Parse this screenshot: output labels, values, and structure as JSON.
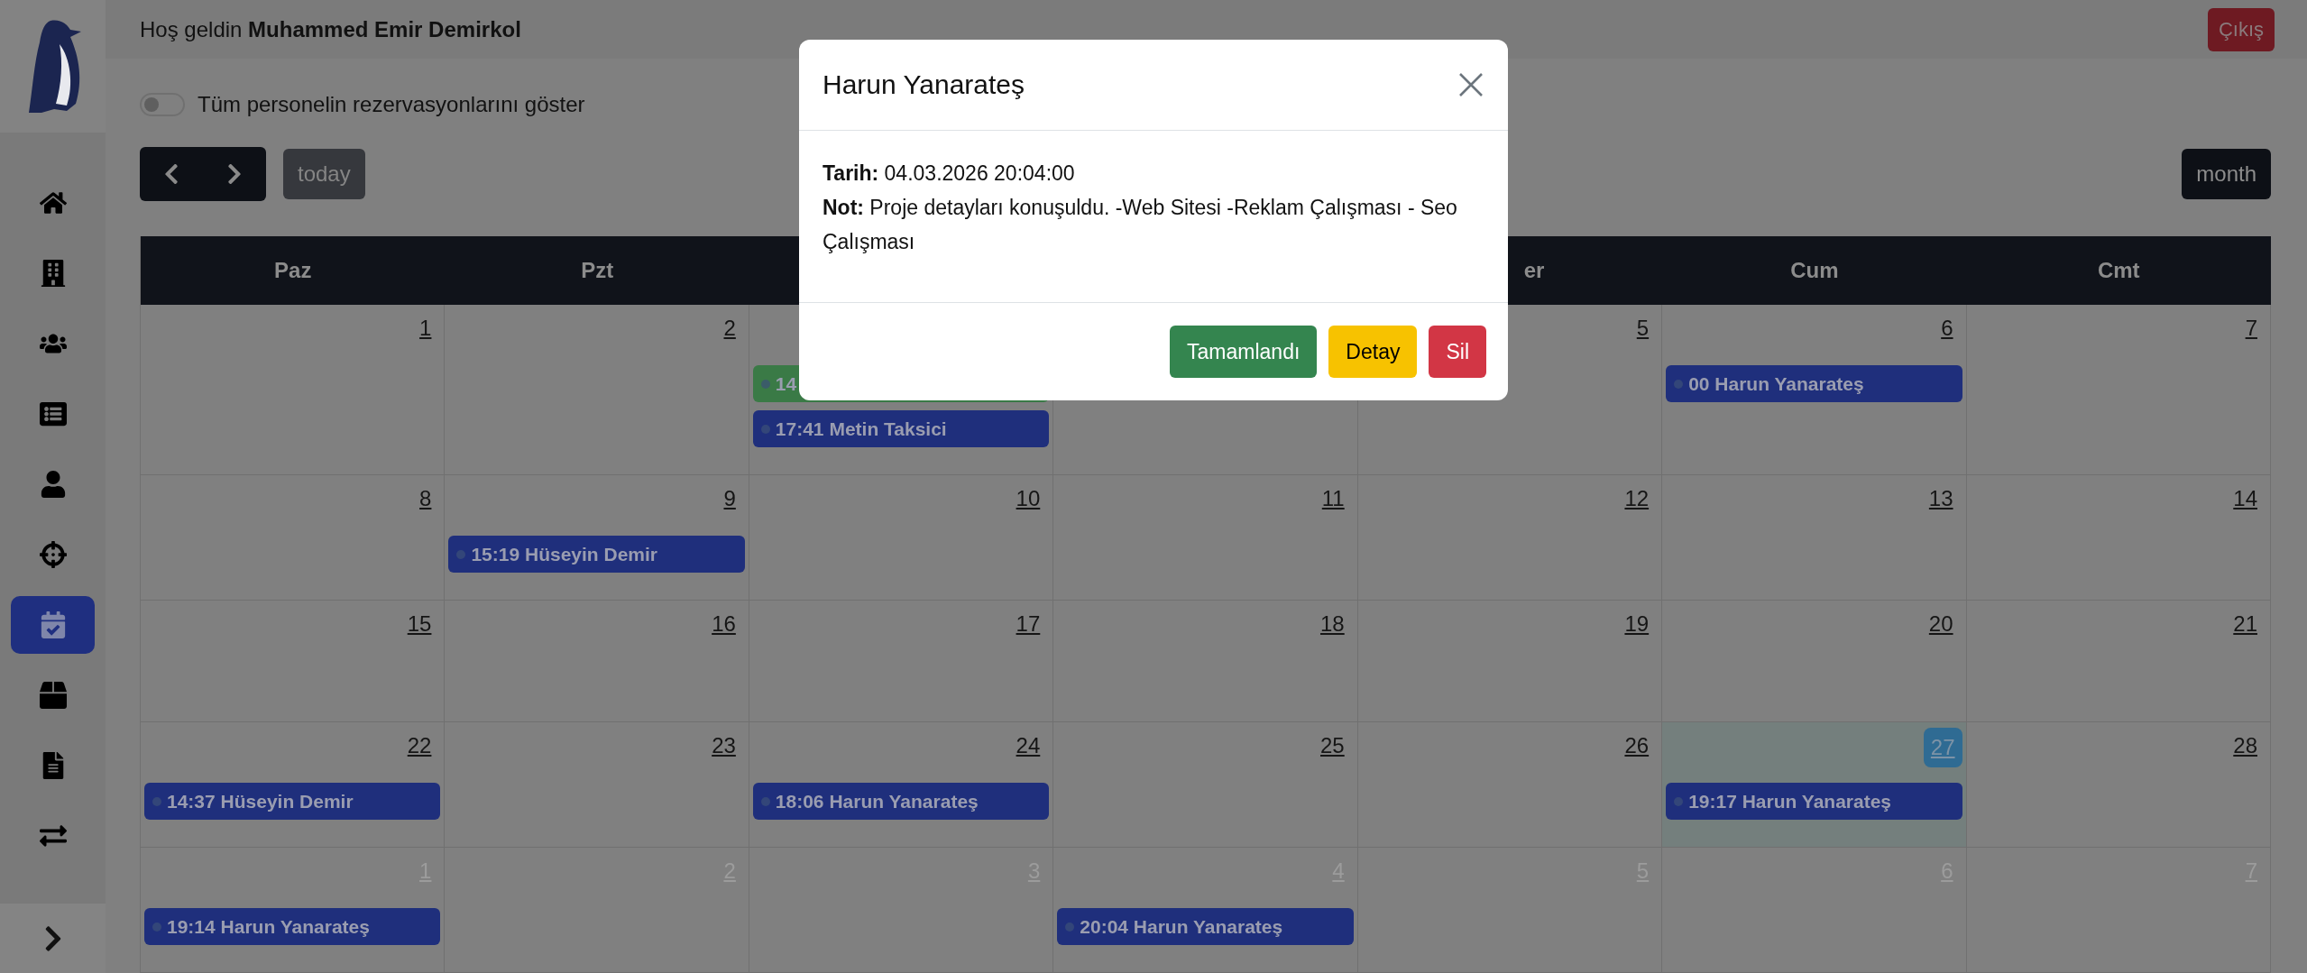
{
  "header": {
    "greeting": "Hoş geldin **Muhammed Emir Demirkol**",
    "logout": "Çıkış"
  },
  "sidebar": {
    "items": [
      {
        "selected": false
      },
      {
        "selected": false
      },
      {
        "selected": false
      },
      {
        "selected": false
      },
      {
        "selected": false
      },
      {
        "selected": false
      },
      {
        "selected": true
      },
      {
        "selected": false
      },
      {
        "selected": false
      },
      {
        "selected": false
      }
    ]
  },
  "toggle": {
    "label": "Tüm personelin rezervasyonlarını göster",
    "on": false
  },
  "toolbar": {
    "today": {
      "label": "today",
      "disabled": true
    },
    "view": {
      "label": "month",
      "selected": true
    }
  },
  "calendar": {
    "weekdays_left": [
      {
        "label": "Paz"
      },
      {
        "label": "Pzt"
      }
    ],
    "weekdays_right": [
      {
        "label": "er",
        "cut": true
      },
      {
        "label": "Cum"
      },
      {
        "label": "Cmt"
      }
    ],
    "weeks": [
      {
        "days": [
          {
            "number": "1",
            "other_month": false,
            "today": false
          },
          {
            "number": "2",
            "other_month": false,
            "today": false
          },
          {
            "today": false,
            "events": [
              {
                "title": "14",
                "color": "#3a7a46"
              },
              {
                "title": "17:41 Metin Taksici",
                "color": "#1f2f7c"
              }
            ]
          },
          {
            "today": false
          },
          {
            "number": "5",
            "other_month": false,
            "today": false
          },
          {
            "number": "6",
            "other_month": false,
            "today": false,
            "events": [
              {
                "title": "00 Harun Yanarateş",
                "color": "#1f2f7c"
              }
            ]
          },
          {
            "number": "7",
            "other_month": false,
            "today": false
          }
        ]
      },
      {
        "days": [
          {
            "number": "8",
            "other_month": false,
            "today": false
          },
          {
            "number": "9",
            "other_month": false,
            "today": false,
            "events": [
              {
                "title": "15:19 Hüseyin Demir",
                "color": "#1f2f7c"
              }
            ]
          },
          {
            "number": "10",
            "other_month": false,
            "today": false
          },
          {
            "number": "11",
            "other_month": false,
            "today": false
          },
          {
            "number": "12",
            "other_month": false,
            "today": false
          },
          {
            "number": "13",
            "other_month": false,
            "today": false
          },
          {
            "number": "14",
            "other_month": false,
            "today": false
          }
        ]
      },
      {
        "days": [
          {
            "number": "15",
            "other_month": false,
            "today": false
          },
          {
            "number": "16",
            "other_month": false,
            "today": false
          },
          {
            "number": "17",
            "other_month": false,
            "today": false
          },
          {
            "number": "18",
            "other_month": false,
            "today": false
          },
          {
            "number": "19",
            "other_month": false,
            "today": false
          },
          {
            "number": "20",
            "other_month": false,
            "today": false
          },
          {
            "number": "21",
            "other_month": false,
            "today": false
          }
        ]
      },
      {
        "days": [
          {
            "number": "22",
            "other_month": false,
            "today": false,
            "events": [
              {
                "title": "14:37 Hüseyin Demir",
                "color": "#1f2f7c"
              }
            ]
          },
          {
            "number": "23",
            "other_month": false,
            "today": false
          },
          {
            "number": "24",
            "other_month": false,
            "today": false,
            "events": [
              {
                "title": "18:06 Harun Yanarateş",
                "color": "#1f2f7c"
              }
            ]
          },
          {
            "number": "25",
            "other_month": false,
            "today": false
          },
          {
            "number": "26",
            "other_month": false,
            "today": false
          },
          {
            "number": "27",
            "other_month": false,
            "today": true,
            "events": [
              {
                "title": "19:17 Harun Yanarateş",
                "color": "#1f2f7c"
              }
            ]
          },
          {
            "number": "28",
            "other_month": false,
            "today": false
          }
        ]
      },
      {
        "days": [
          {
            "number": "1",
            "other_month": true,
            "today": false,
            "events": [
              {
                "title": "19:14 Harun Yanarateş",
                "color": "#1f2f7c"
              }
            ]
          },
          {
            "number": "2",
            "other_month": true,
            "today": false
          },
          {
            "number": "3",
            "other_month": true,
            "today": false
          },
          {
            "number": "4",
            "other_month": true,
            "today": false,
            "events": [
              {
                "title": "20:04 Harun Yanarateş",
                "color": "#1f2f7c"
              }
            ]
          },
          {
            "number": "5",
            "other_month": true,
            "today": false
          },
          {
            "number": "6",
            "other_month": true,
            "today": false
          },
          {
            "number": "7",
            "other_month": true,
            "today": false
          }
        ]
      }
    ]
  },
  "modal": {
    "title": "Harun Yanarateş",
    "lines": [
      "**Tarih:** 04.03.2026 20:04:00",
      "**Not:** Proje detayları konuşuldu. -Web Sitesi -Reklam Çalışması - Seo Çalışması"
    ],
    "buttons": [
      {
        "label": "Tamamlandı",
        "kind": "success"
      },
      {
        "label": "Detay",
        "kind": "warning"
      },
      {
        "label": "Sil",
        "kind": "danger"
      }
    ]
  }
}
